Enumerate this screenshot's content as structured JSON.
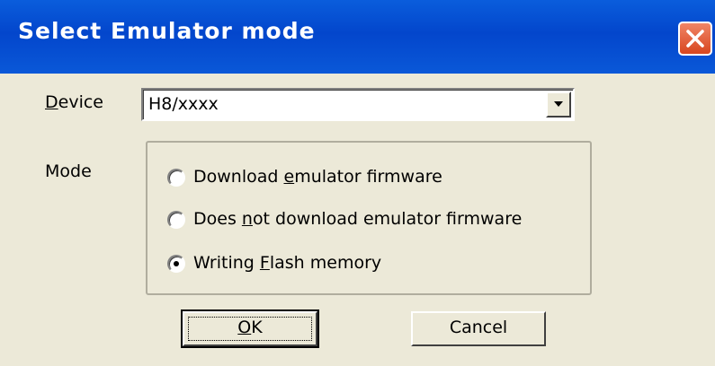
{
  "window": {
    "title": "Select Emulator mode",
    "close_icon": "close-icon"
  },
  "device": {
    "label_prefix": "",
    "label_mnemonic": "D",
    "label_rest": "evice",
    "value": "H8/xxxx",
    "dropdown_icon": "chevron-down-icon"
  },
  "mode": {
    "label": "Mode",
    "options": [
      {
        "pre": "Download ",
        "mn": "e",
        "post": "mulator firmware",
        "selected": false
      },
      {
        "pre": "Does ",
        "mn": "n",
        "post": "ot download emulator firmware",
        "selected": false
      },
      {
        "pre": "Writing ",
        "mn": "F",
        "post": "lash memory",
        "selected": true
      }
    ]
  },
  "buttons": {
    "ok_mn": "O",
    "ok_rest": "K",
    "cancel": "Cancel"
  }
}
